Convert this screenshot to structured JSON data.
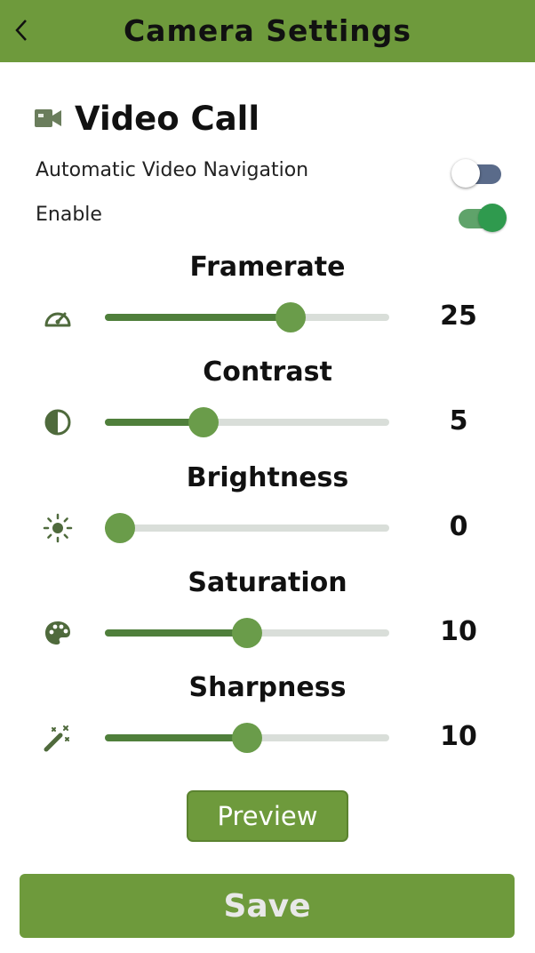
{
  "header": {
    "title": "Camera Settings",
    "back_icon": "chevron-left-icon"
  },
  "section": {
    "title": "Video Call",
    "icon": "video-camera-icon"
  },
  "toggles": [
    {
      "label": "Automatic Video Navigation",
      "state": "off"
    },
    {
      "label": "Enable",
      "state": "on"
    }
  ],
  "sliders": [
    {
      "title": "Framerate",
      "value": "25",
      "icon": "speedometer-icon",
      "level": 0.67
    },
    {
      "title": "Contrast",
      "value": "5",
      "icon": "contrast-icon",
      "level": 0.33
    },
    {
      "title": "Brightness",
      "value": "0",
      "icon": "sun-icon",
      "level": 0.0
    },
    {
      "title": "Saturation",
      "value": "10",
      "icon": "palette-icon",
      "level": 0.5
    },
    {
      "title": "Sharpness",
      "value": "10",
      "icon": "magic-wand-icon",
      "level": 0.5
    }
  ],
  "buttons": {
    "preview": "Preview",
    "save": "Save"
  },
  "colors": {
    "accent": "#6e9a3c",
    "slider_fill": "#4f7f3b",
    "thumb": "#6a9c4a",
    "toggle_on": "#2f9a4e",
    "toggle_off": "#5a6b8a"
  }
}
